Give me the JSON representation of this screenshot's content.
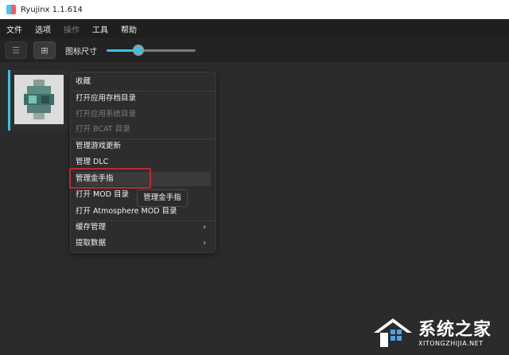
{
  "window": {
    "title": "Ryujinx 1.1.614"
  },
  "menubar": {
    "items": [
      {
        "label": "文件",
        "disabled": false
      },
      {
        "label": "选项",
        "disabled": false
      },
      {
        "label": "操作",
        "disabled": true
      },
      {
        "label": "工具",
        "disabled": false
      },
      {
        "label": "帮助",
        "disabled": false
      }
    ]
  },
  "toolbar": {
    "list_view_icon": "list-icon",
    "grid_view_icon": "grid-icon",
    "icon_size_label": "图标尺寸",
    "icon_size_value": 0.36
  },
  "context_menu": {
    "items": [
      {
        "label": "收藏",
        "disabled": false
      },
      {
        "label": "打开应用存档目录",
        "disabled": false
      },
      {
        "label": "打开应用系统目录",
        "disabled": true
      },
      {
        "label": "打开 BCAT 目录",
        "disabled": true
      },
      {
        "label": "管理游戏更新",
        "disabled": false
      },
      {
        "label": "管理 DLC",
        "disabled": false
      },
      {
        "label": "管理金手指",
        "disabled": false
      },
      {
        "label": "打开 MOD 目录",
        "disabled": false
      },
      {
        "label": "打开 Atmosphere MOD 目录",
        "disabled": false
      },
      {
        "label": "缓存管理",
        "disabled": false
      },
      {
        "label": "提取数据",
        "disabled": false
      }
    ],
    "hovered_item": "管理金手指"
  },
  "tooltip": {
    "text": "管理金手指"
  },
  "colors": {
    "accent": "#37c2e6",
    "highlight": "#c0282d"
  },
  "watermark": {
    "title": "系统之家",
    "url": "XITONGZHIJIA.NET"
  }
}
